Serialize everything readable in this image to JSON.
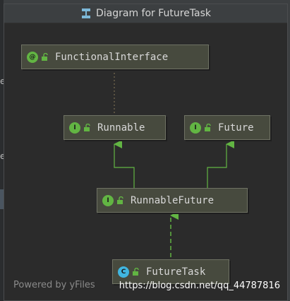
{
  "window": {
    "title": "Diagram for FutureTask"
  },
  "diagram": {
    "nodes": {
      "functional_interface": {
        "kind": "@",
        "label": "FunctionalInterface"
      },
      "runnable": {
        "kind": "I",
        "label": "Runnable"
      },
      "future": {
        "kind": "I",
        "label": "Future"
      },
      "runnable_future": {
        "kind": "I",
        "label": "RunnableFuture"
      },
      "future_task": {
        "kind": "C",
        "label": "FutureTask"
      }
    },
    "edges": [
      {
        "from": "Runnable",
        "to": "FunctionalInterface",
        "style": "dotted annotation"
      },
      {
        "from": "RunnableFuture",
        "to": "Runnable",
        "style": "extends"
      },
      {
        "from": "RunnableFuture",
        "to": "Future",
        "style": "extends"
      },
      {
        "from": "FutureTask",
        "to": "RunnableFuture",
        "style": "implements"
      }
    ],
    "colors": {
      "interface_badge": "#62b543",
      "class_badge": "#40b6e0",
      "edge": "#62b543",
      "node_bg": "#474a3e"
    }
  },
  "footer": {
    "powered_by": "Powered by yFiles"
  },
  "watermark": {
    "text": "https://blog.csdn.net/qq_44787816"
  },
  "background": {
    "side_letters": [
      "e",
      "e"
    ]
  }
}
